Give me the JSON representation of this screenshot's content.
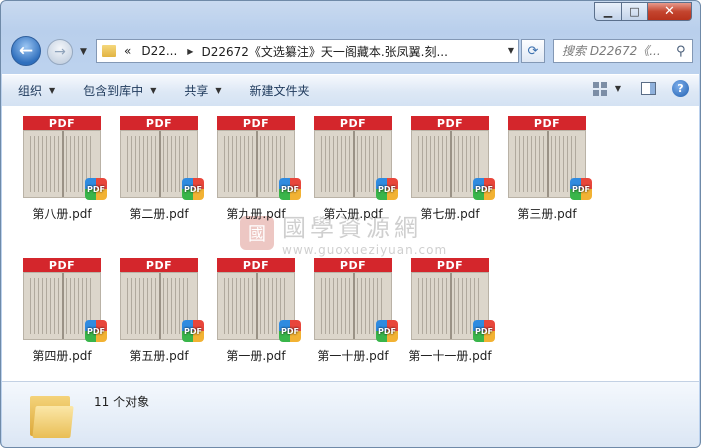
{
  "window": {
    "min_label": "▁",
    "max_label": "□",
    "close_label": "✕"
  },
  "nav": {
    "back_glyph": "←",
    "forward_glyph": "→",
    "breadcrumb_prefix": "«",
    "crumb1": "D22...",
    "crumb2": "D22672《文选纂注》天一阁藏本.张凤翼.刻...",
    "search_placeholder": "搜索 D22672《...",
    "refresh_glyph": "⟳"
  },
  "toolbar": {
    "organize": "组织",
    "include_library": "包含到库中",
    "share": "共享",
    "new_folder": "新建文件夹"
  },
  "files": [
    {
      "name": "第八册.pdf",
      "banner": "PDF"
    },
    {
      "name": "第二册.pdf",
      "banner": "PDF"
    },
    {
      "name": "第九册.pdf",
      "banner": "PDF"
    },
    {
      "name": "第六册.pdf",
      "banner": "PDF"
    },
    {
      "name": "第七册.pdf",
      "banner": "PDF"
    },
    {
      "name": "第三册.pdf",
      "banner": "PDF"
    },
    {
      "name": "第四册.pdf",
      "banner": "PDF"
    },
    {
      "name": "第五册.pdf",
      "banner": "PDF"
    },
    {
      "name": "第一册.pdf",
      "banner": "PDF"
    },
    {
      "name": "第一十册.pdf",
      "banner": "PDF"
    },
    {
      "name": "第一十一册.pdf",
      "banner": "PDF"
    }
  ],
  "badge_text": "PDF",
  "watermark": {
    "seal": "國",
    "title": "國學資源網",
    "url": "www.guoxueziyuan.com"
  },
  "status": {
    "count_text": "11 个对象"
  },
  "colors": {
    "pdf_banner": "#d4262c",
    "window_frame": "#b9cfec",
    "accent": "#2f6fbd"
  }
}
